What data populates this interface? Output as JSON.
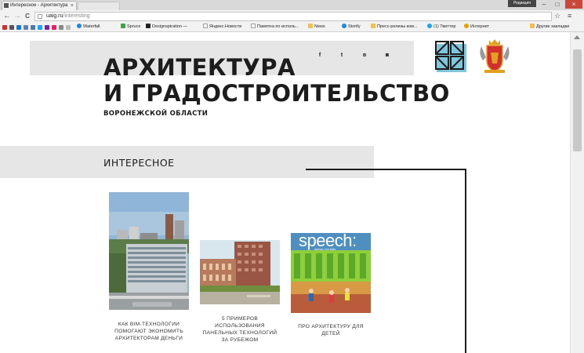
{
  "browser": {
    "tab_title": "Интересное - Архитектура",
    "tab_close": "×",
    "user_badge": "Редакция",
    "window_controls": [
      "–",
      "□",
      "×"
    ],
    "nav": {
      "back": "←",
      "forward": "→",
      "reload": "C"
    },
    "url_host": "uaig.ru",
    "url_path": "/interesting",
    "star": "☆",
    "menu": "≡"
  },
  "bookmarks": [
    {
      "label": "Waterfall",
      "color": "#1e88e5"
    },
    {
      "label": "Spruce",
      "color": "#43a047"
    },
    {
      "label": "Designspiration —",
      "color": "#222222"
    },
    {
      "label": "Яндекс.Новости",
      "color": "#777777"
    },
    {
      "label": "Памятка по исполь...",
      "color": "#777777"
    },
    {
      "label": "News",
      "color": "#f0a000"
    },
    {
      "label": "Storify",
      "color": "#1e88e5"
    },
    {
      "label": "Пресс-релизы ком...",
      "color": "#f0a000"
    },
    {
      "label": "(1) Твиттер",
      "color": "#1da1f2"
    },
    {
      "label": "Интернет",
      "color": "#e8a000"
    }
  ],
  "other_bookmarks": "Другие закладки",
  "site": {
    "title_line1": "АРХИТЕКТУРА",
    "title_line2": "И ГРАДОСТРОИТЕЛЬСТВО",
    "subtitle": "ВОРОНЕЖСКОЙ ОБЛАСТИ",
    "social": {
      "facebook": "f",
      "twitter": "t",
      "vk": "в",
      "instagram": "◙"
    }
  },
  "section": {
    "title": "ИНТЕРЕСНОЕ"
  },
  "cards": [
    {
      "caption": "КАК BIM-ТЕХНОЛОГИИ ПОМОГАЮТ ЭКОНОМИТЬ АРХИТЕКТОРАМ ДЕНЬГИ"
    },
    {
      "caption": "5 ПРИМЕРОВ ИСПОЛЬЗОВАНИЯ ПАНЕЛЬНЫХ ТЕХНОЛОГИЙ ЗА РУБЕЖОМ"
    },
    {
      "caption": "ПРО АРХИТЕКТУРУ ДЛЯ ДЕТЕЙ",
      "image_text": "speech:",
      "image_subtext": "detms / for kids"
    }
  ],
  "colors": {
    "band": "#e6e6e6",
    "text": "#1c1c1c",
    "logo_blue": "#7fc6dc"
  }
}
